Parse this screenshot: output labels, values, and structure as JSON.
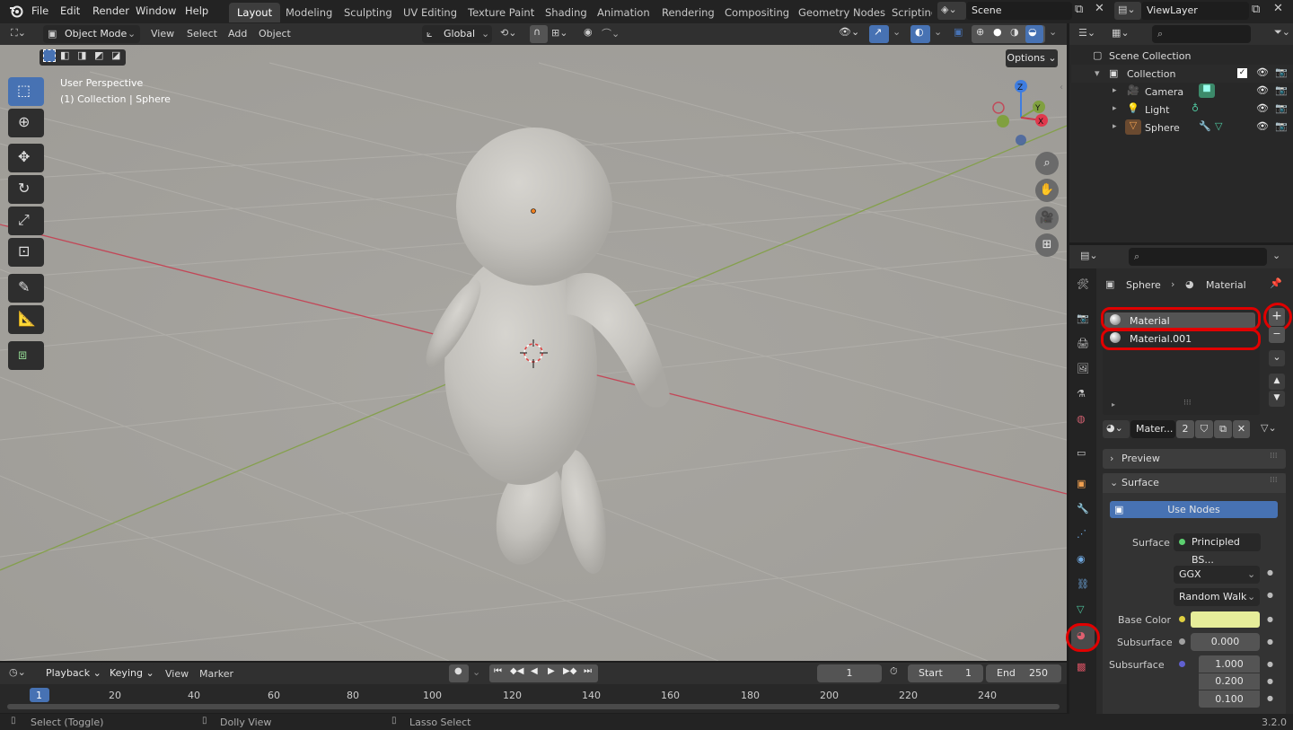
{
  "topbar": {
    "menus": [
      "File",
      "Edit",
      "Render",
      "Window",
      "Help"
    ],
    "workspaces": [
      "Layout",
      "Modeling",
      "Sculpting",
      "UV Editing",
      "Texture Paint",
      "Shading",
      "Animation",
      "Rendering",
      "Compositing",
      "Geometry Nodes",
      "Scripting"
    ],
    "active_workspace": "Layout",
    "scene": "Scene",
    "view_layer": "ViewLayer"
  },
  "viewport_header": {
    "mode": "Object Mode",
    "menus": [
      "View",
      "Select",
      "Add",
      "Object"
    ],
    "orientation": "Global",
    "options": "Options"
  },
  "viewport": {
    "perspective": "User Perspective",
    "collection_info": "(1) Collection | Sphere",
    "gizmo": {
      "z": "Z",
      "y": "Y",
      "x": "X"
    }
  },
  "outliner": {
    "root": "Scene Collection",
    "collection": "Collection",
    "items": [
      "Camera",
      "Light",
      "Sphere"
    ]
  },
  "properties": {
    "breadcrumb_object": "Sphere",
    "breadcrumb_material": "Material",
    "slots": [
      "Material",
      "Material.001"
    ],
    "datablock_name": "Mater...",
    "user_count": "2",
    "panel_preview": "Preview",
    "panel_surface": "Surface",
    "use_nodes": "Use Nodes",
    "surface_label": "Surface",
    "surface_value": "Principled BS...",
    "distribution": "GGX",
    "subsurface_method": "Random Walk",
    "base_color_label": "Base Color",
    "base_color": "#e6ed9a",
    "subsurface_label": "Subsurface",
    "subsurface_value": "0.000",
    "subsurface_radius_label": "Subsurface",
    "subsurface_radius": [
      "1.000",
      "0.200",
      "0.100"
    ]
  },
  "timeline": {
    "menus": [
      "Playback",
      "Keying",
      "View",
      "Marker"
    ],
    "current_frame": "1",
    "start_label": "Start",
    "start": "1",
    "end_label": "End",
    "end": "250",
    "ruler": [
      "1",
      "20",
      "40",
      "60",
      "80",
      "100",
      "120",
      "140",
      "160",
      "180",
      "200",
      "220",
      "240"
    ]
  },
  "statusbar": {
    "hint1": "Select (Toggle)",
    "hint2": "Dolly View",
    "hint3": "Lasso Select",
    "version": "3.2.0"
  },
  "colors": {
    "accent": "#4772b3",
    "highlight_ring": "#e00000",
    "x_axis": "#c8384c",
    "y_axis": "#80a040",
    "z_axis": "#3f7de0"
  }
}
